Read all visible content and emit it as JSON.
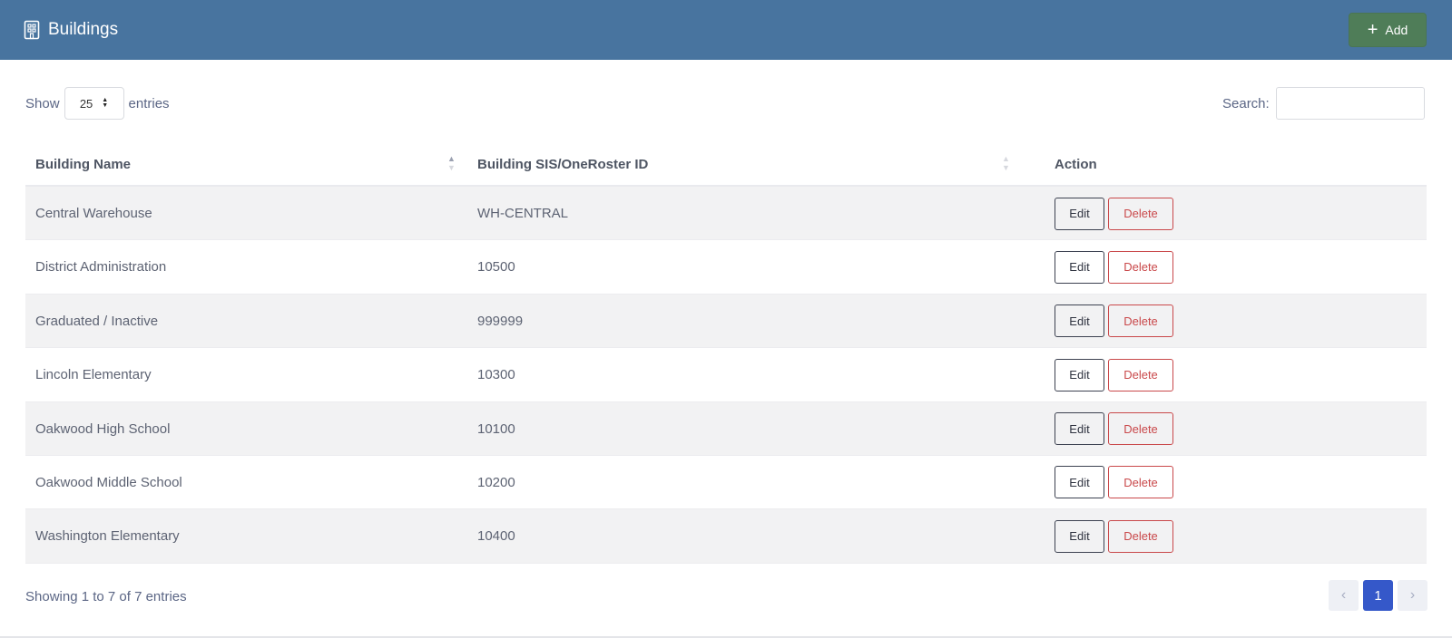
{
  "header": {
    "title": "Buildings",
    "add_label": "Add",
    "icon": "building-icon",
    "bg_color": "#48749f",
    "add_color": "#4f7d58"
  },
  "controls": {
    "show_label": "Show",
    "page_length": "25",
    "entries_label": "entries",
    "search_label": "Search:",
    "search_value": "",
    "search_placeholder": ""
  },
  "table": {
    "columns": [
      "Building Name",
      "Building SIS/OneRoster ID",
      "Action"
    ],
    "edit_label": "Edit",
    "delete_label": "Delete",
    "rows": [
      {
        "name": "Central Warehouse",
        "id": "WH-CENTRAL"
      },
      {
        "name": "District Administration",
        "id": "10500"
      },
      {
        "name": "Graduated / Inactive",
        "id": "999999"
      },
      {
        "name": "Lincoln Elementary",
        "id": "10300"
      },
      {
        "name": "Oakwood High School",
        "id": "10100"
      },
      {
        "name": "Oakwood Middle School",
        "id": "10200"
      },
      {
        "name": "Washington Elementary",
        "id": "10400"
      }
    ]
  },
  "footer": {
    "info": "Showing 1 to 7 of 7 entries",
    "prev": "‹",
    "page": "1",
    "next": "›",
    "active_color": "#3558c9"
  }
}
